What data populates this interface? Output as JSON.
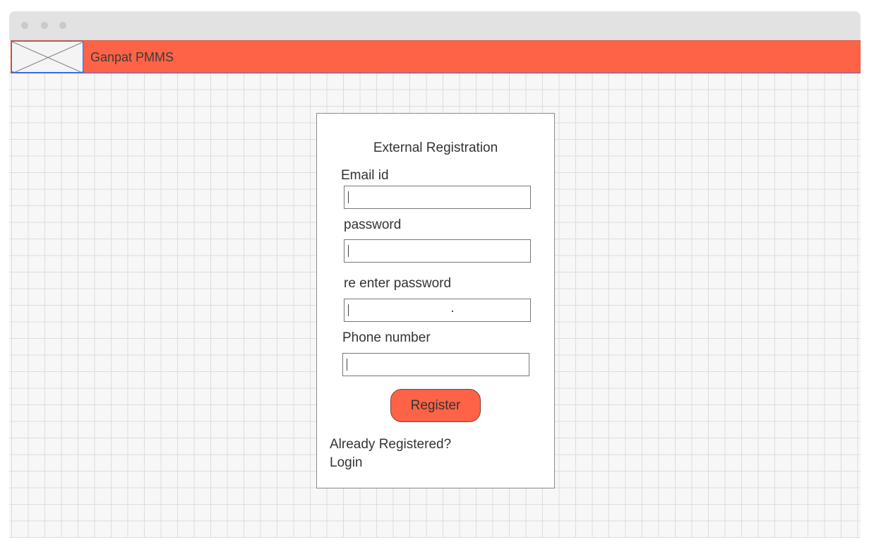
{
  "header": {
    "app_title": "Ganpat PMMS",
    "accent_color": "#ff6347"
  },
  "registration_form": {
    "title": "External Registration",
    "email": {
      "label": "Email id",
      "value": ""
    },
    "password": {
      "label": "password",
      "value": ""
    },
    "reenter_password": {
      "label": "re enter password",
      "value": ""
    },
    "phone": {
      "label": "Phone number",
      "value": ""
    },
    "register_label": "Register",
    "already_registered_text": "Already Registered?",
    "login_label": "Login"
  },
  "icons": {
    "logo": "image-placeholder-icon",
    "window_controls": "traffic-light-dots"
  }
}
